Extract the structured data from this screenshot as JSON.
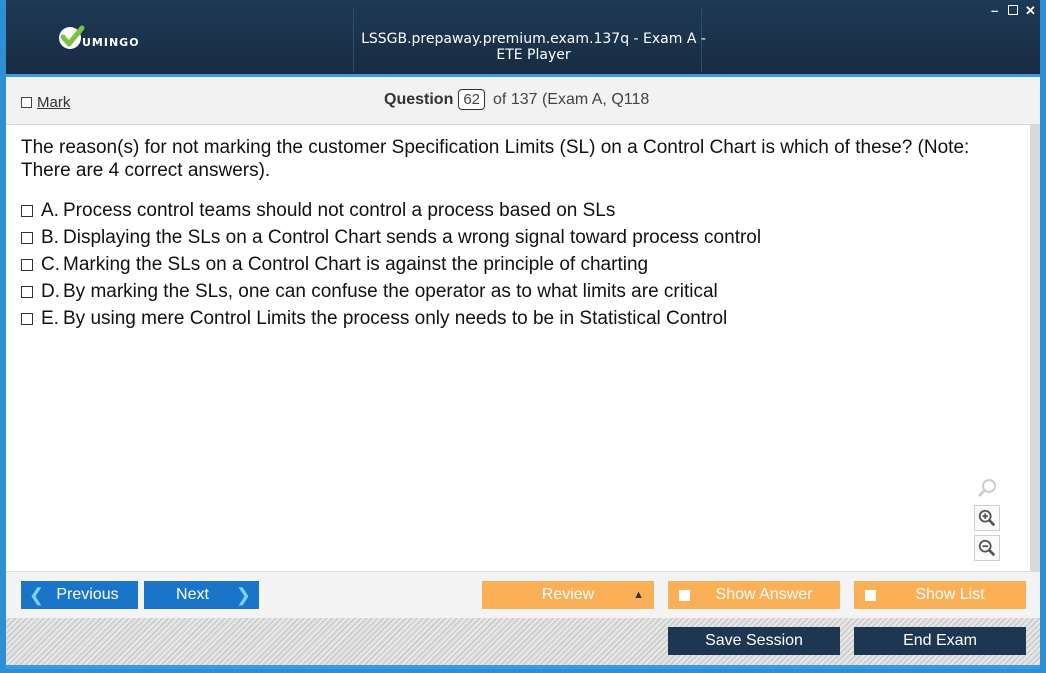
{
  "app": {
    "logo_text": "UMINGO",
    "window_title": "LSSGB.prepaway.premium.exam.137q - Exam A - ETE Player",
    "window_controls": [
      "minimize-icon",
      "maximize-icon",
      "close-icon"
    ]
  },
  "header": {
    "mark_label": "Mark",
    "question_label": "Question",
    "question_number": "62",
    "question_of": "of 137 (Exam A, Q118"
  },
  "question": {
    "text": "The reason(s) for not marking the customer Specification Limits (SL) on a Control Chart is which of these? (Note: There are 4 correct answers).",
    "options": [
      {
        "letter": "A.",
        "text": "Process control teams should not control a process based on SLs"
      },
      {
        "letter": "B.",
        "text": "Displaying the SLs on a Control Chart sends a wrong signal toward process control"
      },
      {
        "letter": "C.",
        "text": "Marking the SLs on a Control Chart is against the principle of charting"
      },
      {
        "letter": "D.",
        "text": "By marking the SLs, one can confuse the operator as to what limits are critical"
      },
      {
        "letter": "E.",
        "text": "By using mere Control Limits the process only needs to be in Statistical Control"
      }
    ]
  },
  "zoom": [
    "zoom-reset-icon",
    "zoom-in-icon",
    "zoom-out-icon"
  ],
  "nav": {
    "previous_label": "Previous",
    "next_label": "Next",
    "review_label": "Review",
    "show_answer_label": "Show Answer",
    "show_list_label": "Show List",
    "save_session_label": "Save Session",
    "end_exam_label": "End Exam"
  },
  "colors": {
    "titlebar": "#1b3450",
    "accent_blue": "#1a75c9",
    "orange": "#fbb057",
    "dark_button": "#1d3752"
  }
}
